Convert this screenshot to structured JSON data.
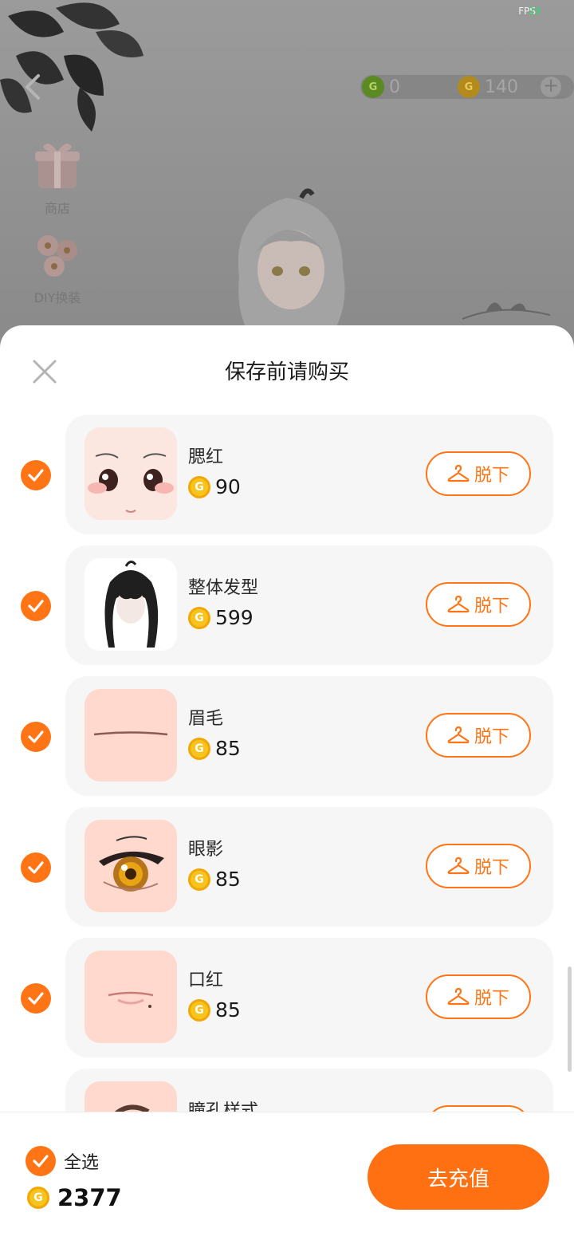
{
  "hud": {
    "fps_label": "FPS",
    "fps_value": "29",
    "green_currency": "0",
    "gold_currency": "140",
    "side_items": [
      {
        "label": "商店"
      },
      {
        "label": "DIY换装"
      }
    ]
  },
  "sheet": {
    "title": "保存前请购买",
    "take_off_label": "脱下",
    "items": [
      {
        "name": "腮红",
        "price": "90",
        "checked": true,
        "thumb": "blush"
      },
      {
        "name": "整体发型",
        "price": "599",
        "checked": true,
        "thumb": "hair"
      },
      {
        "name": "眉毛",
        "price": "85",
        "checked": true,
        "thumb": "brow"
      },
      {
        "name": "眼影",
        "price": "85",
        "checked": true,
        "thumb": "eye"
      },
      {
        "name": "口红",
        "price": "85",
        "checked": true,
        "thumb": "lips"
      },
      {
        "name": "瞳孔样式",
        "price": "",
        "checked": true,
        "thumb": "pupil"
      }
    ]
  },
  "footer": {
    "select_all_label": "全选",
    "total": "2377",
    "recharge_label": "去充值"
  },
  "colors": {
    "accent": "#ff7516",
    "coin": "#f7c31d",
    "card_bg": "#f6f6f6"
  }
}
